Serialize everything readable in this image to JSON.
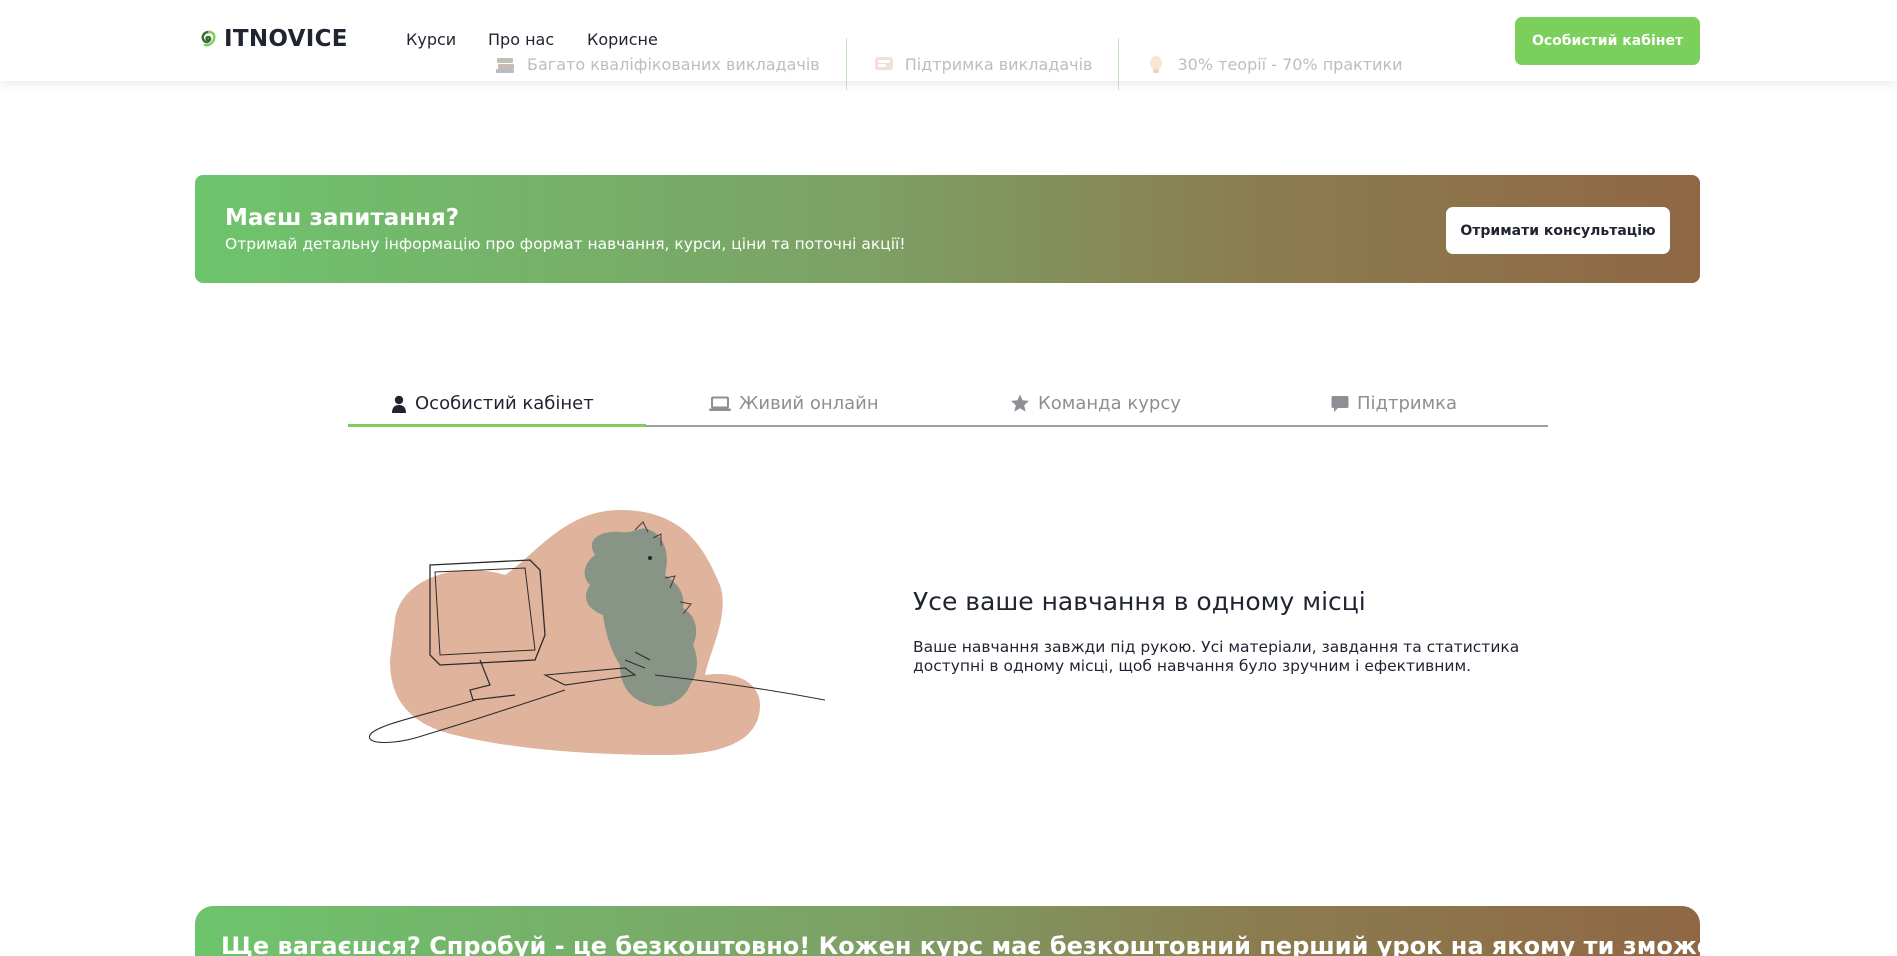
{
  "header": {
    "logo_text": "ITNOVICE",
    "nav": [
      "Курси",
      "Про нас",
      "Корисне"
    ],
    "ticker": [
      {
        "icon": "books-icon",
        "text": "Багато кваліфікованих викладачів"
      },
      {
        "icon": "chat-bubble-icon",
        "text": "Підтримка викладачів"
      },
      {
        "icon": "lightbulb-icon",
        "text": "30% теорії - 70% практики"
      }
    ],
    "cabinet_button": "Особистий кабінет"
  },
  "banner": {
    "title": "Маєш запитання?",
    "subtitle": "Отримай детальну інформацію про формат навчання, курси, ціни та поточні акції!",
    "button": "Отримати консультацію"
  },
  "tabs": [
    {
      "label": "Особистий кабінет",
      "icon": "user-icon",
      "active": true
    },
    {
      "label": "Живий онлайн",
      "icon": "laptop-icon",
      "active": false
    },
    {
      "label": "Команда курсу",
      "icon": "star-icon",
      "active": false
    },
    {
      "label": "Підтримка",
      "icon": "comment-icon",
      "active": false
    }
  ],
  "content": {
    "title": "Усе ваше навчання в одному місці",
    "text": "Ваше навчання завжди під рукою. Усі матеріали, завдання та статистика доступні в одному місці, щоб навчання було зручним і ефективним."
  },
  "bottom_banner": {
    "text": "Ще вагаєшся? Спробуй - це безкоштовно! Кожен курс має безкоштовний перший урок на якому ти зможеш:"
  },
  "colors": {
    "accent": "#7bcf5b",
    "gradient_start": "#6ec46d",
    "gradient_end": "#8f6744",
    "text": "#1f2430",
    "muted": "#8d8f94"
  }
}
